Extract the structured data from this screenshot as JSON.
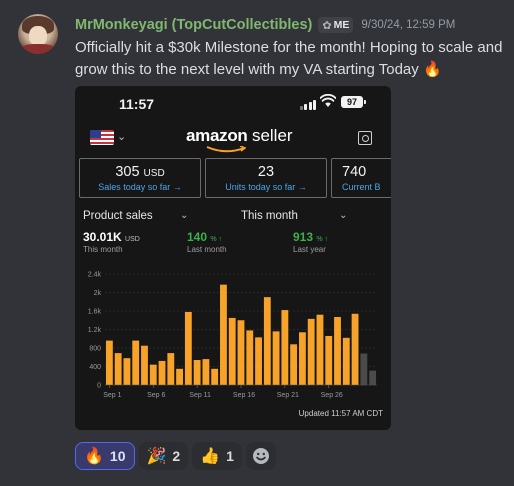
{
  "message": {
    "username": "MrMonkeyagi (TopCutCollectibles)",
    "badge_text": "ME",
    "badge_icon": "lotus-icon",
    "timestamp": "9/30/24, 12:59 PM",
    "text": "Officially hit a $30k Milestone for the month! Hoping to scale and grow this to the next level with my VA starting Today",
    "text_emoji": "🔥",
    "username_color": "#80b870"
  },
  "screenshot": {
    "status_time": "11:57",
    "battery": "97",
    "brand_word1": "amazon",
    "brand_word2": "seller",
    "tiles": [
      {
        "value": "305",
        "unit": "USD",
        "label": "Sales today so far →"
      },
      {
        "value": "23",
        "unit": "",
        "label": "Units today so far →"
      },
      {
        "value": "740",
        "unit": "",
        "label": "Current B"
      }
    ],
    "selectors": {
      "left": "Product sales",
      "right": "This month"
    },
    "metrics": [
      {
        "value": "30.01K",
        "unit": "USD",
        "label": "This month",
        "color": "#ffffff"
      },
      {
        "value": "140",
        "unit": "% ↑",
        "label": "Last month",
        "color": "#3cb04a"
      },
      {
        "value": "913",
        "unit": "% ↑",
        "label": "Last year",
        "color": "#3cb04a"
      }
    ],
    "updated": "Updated 11:57 AM CDT"
  },
  "chart_data": {
    "type": "bar",
    "y_ticks": [
      "2.4k",
      "2k",
      "1.6k",
      "1.2k",
      "800",
      "400",
      "0"
    ],
    "x_tick_labels": [
      "Sep 1",
      "Sep 6",
      "Sep 11",
      "Sep 16",
      "Sep 21",
      "Sep 26"
    ],
    "ylim": [
      0,
      2400
    ],
    "series": [
      {
        "color": "#f7a228",
        "values": [
          960,
          690,
          580,
          960,
          850,
          440,
          520,
          690,
          350,
          1580,
          540,
          560,
          350,
          2170,
          1450,
          1400,
          1180,
          1030,
          1900,
          1160,
          1620,
          880,
          1140,
          1430,
          1520,
          1060,
          1470,
          1020,
          1540
        ]
      },
      {
        "color": "#4b4b4b",
        "values_from_day": 30,
        "values": [
          680,
          310
        ]
      }
    ]
  },
  "reactions": [
    {
      "emoji": "🔥",
      "count": "10",
      "active": true
    },
    {
      "emoji": "🎉",
      "count": "2",
      "active": false
    },
    {
      "emoji": "👍",
      "count": "1",
      "active": false
    }
  ],
  "colors": {
    "background": "#313338",
    "accent": "#5865f2",
    "bar": "#f7a228",
    "link": "#4aa6e8"
  }
}
